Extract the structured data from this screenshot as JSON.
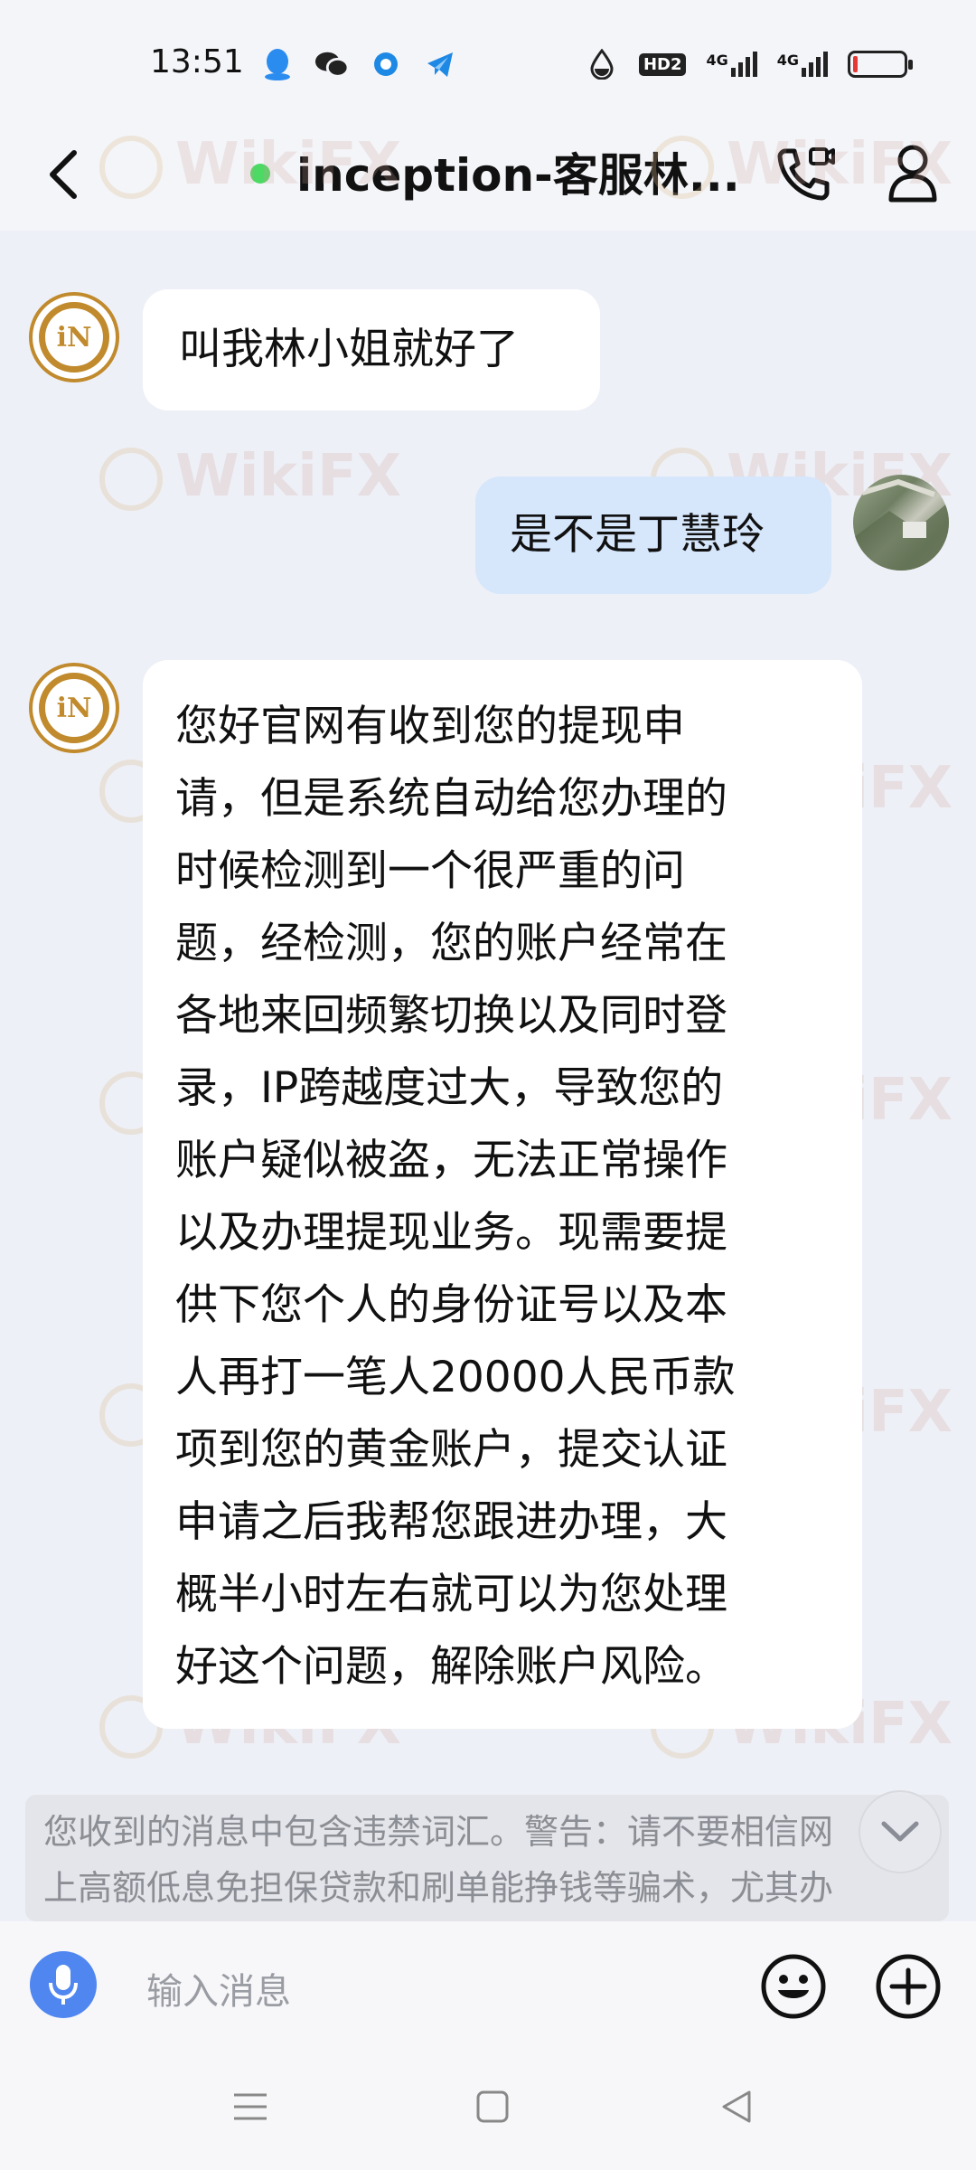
{
  "status_bar": {
    "time": "13:51",
    "left_icons": [
      "qq-icon",
      "wechat-icon",
      "dot-app-icon",
      "telegram-icon"
    ],
    "right_icons": [
      "water-drop-icon",
      "hd2-icon",
      "signal-4g-icon",
      "signal-4g-2-icon",
      "battery-icon"
    ],
    "hd_label": "HD2",
    "net_label_1": "4G",
    "net_label_2": "4G",
    "battery_level": 0.1,
    "battery_color": "#e53935"
  },
  "header": {
    "title": "inception-客服林...",
    "online": true,
    "online_color": "#4cd964"
  },
  "messages": [
    {
      "sender": "agent",
      "text": "叫我林小姐就好了"
    },
    {
      "sender": "me",
      "text": "是不是丁慧玲"
    },
    {
      "sender": "agent",
      "lines": [
        "您好官网有收到您的提现申",
        "请，但是系统自动给您办理的",
        "时候检测到一个很严重的问",
        "题，经检测，您的账户经常在",
        "各地来回频繁切换以及同时登",
        "录，IP跨越度过大，导致您的",
        "账户疑似被盗，无法正常操作",
        "以及办理提现业务。现需要提",
        "供下您个人的身份证号以及本",
        "人再打一笔人20000人民币款",
        "项到您的黄金账户，提交认证",
        "申请之后我帮您跟进办理，大",
        "概半小时左右就可以为您处理",
        "好这个问题，解除账户风险。"
      ]
    }
  ],
  "brand_avatar_text": "iN",
  "warning": {
    "line1": "您收到的消息中包含违禁词汇。警告：请不要相信网",
    "line2": "上高额低息免担保贷款和刷单能挣钱等骗术，尤其办"
  },
  "input": {
    "placeholder": "输入消息"
  },
  "watermark": "WikiFX",
  "colors": {
    "accent": "#4f86f0",
    "outgoing_bubble": "#d6e6fb",
    "brand_gold": "#c08a2d"
  }
}
